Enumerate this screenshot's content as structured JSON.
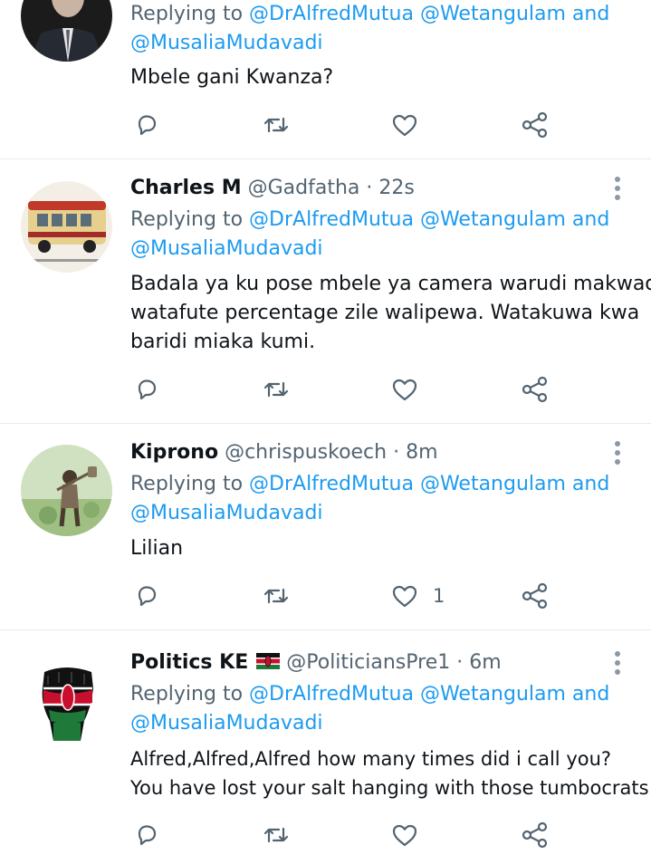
{
  "tweets": [
    {
      "name": "",
      "handle": "",
      "time": "",
      "reply_prefix": "Replying to",
      "reply_line1": "@DrAlfredMutua @Wetangulam and",
      "reply_line2": "@MusaliaMudavadi",
      "text_lines": [
        "Mbele gani Kwanza?"
      ],
      "like_count": ""
    },
    {
      "name": "Charles M",
      "handle": "@Gadfatha",
      "time": "22s",
      "reply_prefix": "Replying to",
      "reply_line1": "@DrAlfredMutua @Wetangulam and",
      "reply_line2": "@MusaliaMudavadi",
      "text_lines": [
        "Badala ya ku pose mbele ya camera warudi makwao",
        "watafute percentage zile walipewa. Watakuwa kwa",
        "baridi miaka kumi."
      ],
      "like_count": ""
    },
    {
      "name": "Kiprono",
      "handle": "@chrispuskoech",
      "time": "8m",
      "reply_prefix": "Replying to",
      "reply_line1": "@DrAlfredMutua @Wetangulam and",
      "reply_line2": "@MusaliaMudavadi",
      "text_lines": [
        "Lilian"
      ],
      "like_count": "1"
    },
    {
      "name": "Politics KE",
      "handle": "@PoliticiansPre1",
      "time": "6m",
      "reply_prefix": "Replying to",
      "reply_line1": "@DrAlfredMutua @Wetangulam and",
      "reply_line2": "@MusaliaMudavadi",
      "text_lines": [
        "Alfred,Alfred,Alfred how many times did i call you?",
        "You have lost your salt hanging with those tumbocrats"
      ],
      "like_count": ""
    }
  ],
  "separator": "·",
  "icons": {
    "reply": "reply-icon",
    "retweet": "retweet-icon",
    "like": "heart-icon",
    "share": "share-icon",
    "more": "more-icon",
    "flag": "kenya-flag-icon"
  },
  "colors": {
    "mention": "#1d9bf0",
    "secondary_text": "#536471",
    "divider": "#e6ecf0"
  }
}
